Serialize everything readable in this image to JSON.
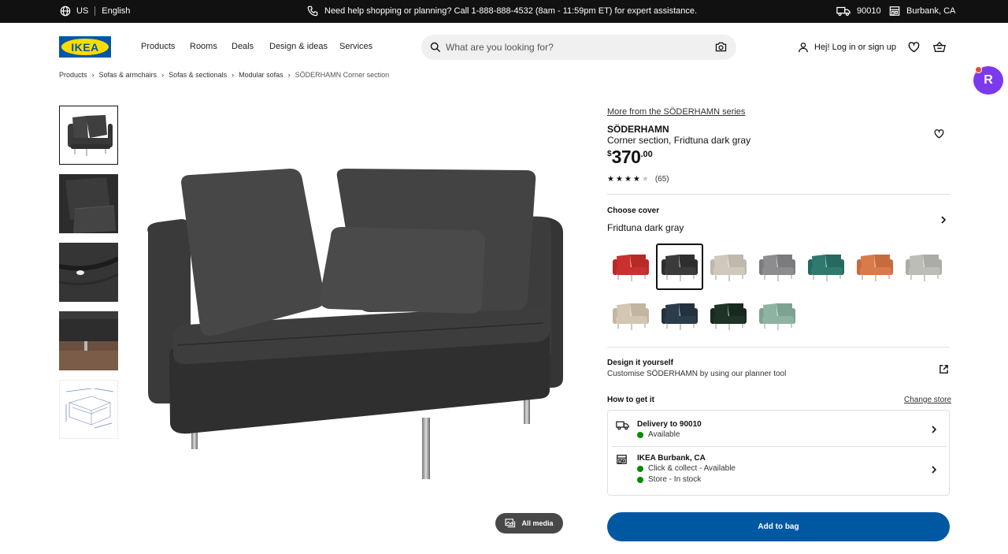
{
  "topbar": {
    "country": "US",
    "language": "English",
    "help_text": "Need help shopping or planning? Call 1-888-888-4532 (8am - 11:59pm ET) for expert assistance.",
    "zip": "90010",
    "store": "Burbank, CA"
  },
  "header": {
    "logo_text": "IKEA",
    "nav": [
      "Products",
      "Rooms",
      "Deals",
      "Design & ideas",
      "Services"
    ],
    "search_placeholder": "What are you looking for?",
    "login_label": "Hej! Log in or sign up"
  },
  "floating_badge": {
    "letter": "R"
  },
  "breadcrumb": [
    "Products",
    "Sofas & armchairs",
    "Sofas & sectionals",
    "Modular sofas",
    "SÖDERHAMN Corner section"
  ],
  "gallery": {
    "all_media_label": "All media",
    "thumbnails": [
      "thumb-front",
      "thumb-pillows",
      "thumb-fabric",
      "thumb-legs",
      "thumb-dimensions"
    ]
  },
  "product": {
    "series_link": "More from the SÖDERHAMN series",
    "name": "SÖDERHAMN",
    "description": "Corner section, Fridtuna dark gray",
    "price_currency": "$",
    "price_int": "370",
    "price_dec": ".00",
    "rating": 4,
    "rating_max": 5,
    "review_count": "(65)"
  },
  "cover": {
    "title": "Choose cover",
    "selected": "Fridtuna dark gray",
    "swatches": [
      {
        "name": "red",
        "color": "#c8312f",
        "back": "#b82a28"
      },
      {
        "name": "dark-gray",
        "color": "#3b3b3b",
        "back": "#2e2e2e",
        "selected": true
      },
      {
        "name": "beige",
        "color": "#cfc9bd",
        "back": "#bfb8ab"
      },
      {
        "name": "gray",
        "color": "#8d8d8f",
        "back": "#7b7b7d"
      },
      {
        "name": "teal",
        "color": "#2f7a6e",
        "back": "#27695e"
      },
      {
        "name": "orange",
        "color": "#d97a4a",
        "back": "#c86b3c"
      },
      {
        "name": "light-gray",
        "color": "#bdbdb7",
        "back": "#acaca6"
      },
      {
        "name": "sand",
        "color": "#d3c7b3",
        "back": "#c2b6a1"
      },
      {
        "name": "dark-blue",
        "color": "#2b3d4b",
        "back": "#23323e"
      },
      {
        "name": "dark-green",
        "color": "#1f3326",
        "back": "#182a1f"
      },
      {
        "name": "sage",
        "color": "#8fb3a2",
        "back": "#7ea291"
      }
    ]
  },
  "design": {
    "title": "Design it yourself",
    "subtitle": "Customise SÖDERHAMN by using our planner tool"
  },
  "availability": {
    "title": "How to get it",
    "change_store": "Change store",
    "delivery_title": "Delivery to 90010",
    "delivery_status": "Available",
    "store_title": "IKEA Burbank, CA",
    "collect_status": "Click & collect - Available",
    "stock_status": "Store - In stock"
  },
  "cta": {
    "add_to_bag": "Add to bag"
  },
  "colors": {
    "brand_blue": "#0058a3",
    "brand_yellow": "#ffdb00",
    "available_green": "#0a8a00"
  }
}
